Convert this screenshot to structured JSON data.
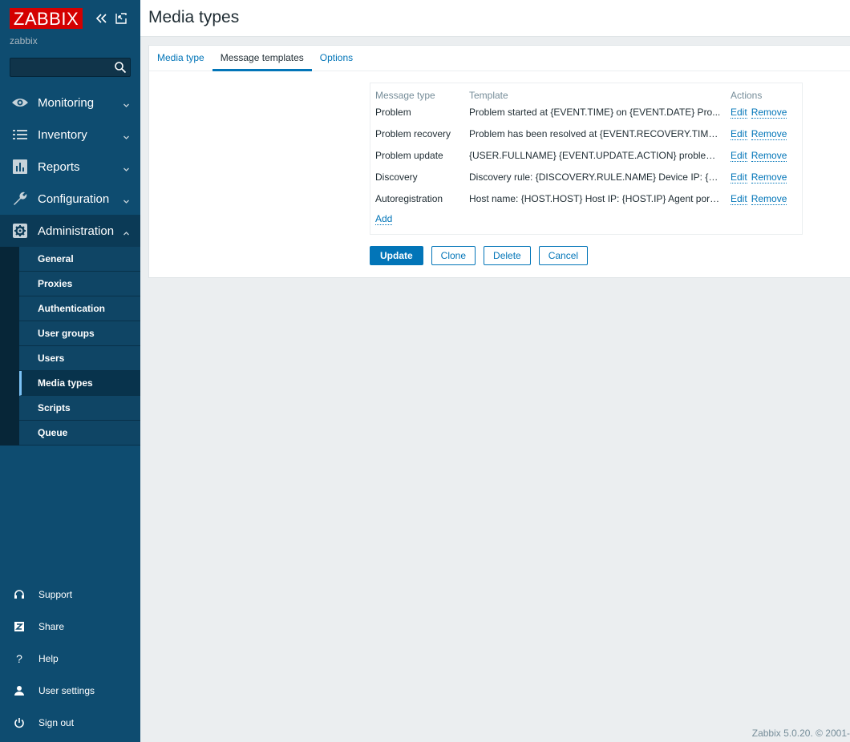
{
  "app": {
    "logo_text": "ZABBIX",
    "server_name": "zabbix"
  },
  "sidebar": {
    "menu": [
      {
        "label": "Monitoring",
        "icon": "eye-icon"
      },
      {
        "label": "Inventory",
        "icon": "list-icon"
      },
      {
        "label": "Reports",
        "icon": "bar-chart-icon"
      },
      {
        "label": "Configuration",
        "icon": "wrench-icon"
      },
      {
        "label": "Administration",
        "icon": "gear-icon",
        "expanded": true
      }
    ],
    "submenu": [
      "General",
      "Proxies",
      "Authentication",
      "User groups",
      "Users",
      "Media types",
      "Scripts",
      "Queue"
    ],
    "submenu_selected": "Media types",
    "bottom": [
      {
        "label": "Support",
        "icon": "headset-icon"
      },
      {
        "label": "Share",
        "icon": "share-z-icon"
      },
      {
        "label": "Help",
        "icon": "help-icon"
      },
      {
        "label": "User settings",
        "icon": "user-icon"
      },
      {
        "label": "Sign out",
        "icon": "power-icon"
      }
    ]
  },
  "header": {
    "title": "Media types"
  },
  "tabs": [
    {
      "label": "Media type",
      "active": false
    },
    {
      "label": "Message templates",
      "active": true
    },
    {
      "label": "Options",
      "active": false
    }
  ],
  "templates": {
    "columns": [
      "Message type",
      "Template",
      "Actions"
    ],
    "rows": [
      {
        "type": "Problem",
        "template": "Problem started at {EVENT.TIME} on {EVENT.DATE} Pro..."
      },
      {
        "type": "Problem recovery",
        "template": "Problem has been resolved at {EVENT.RECOVERY.TIME..."
      },
      {
        "type": "Problem update",
        "template": "{USER.FULLNAME} {EVENT.UPDATE.ACTION} problem ..."
      },
      {
        "type": "Discovery",
        "template": "Discovery rule: {DISCOVERY.RULE.NAME} Device IP: {D..."
      },
      {
        "type": "Autoregistration",
        "template": "Host name: {HOST.HOST} Host IP: {HOST.IP} Agent port:..."
      }
    ],
    "edit_label": "Edit",
    "remove_label": "Remove",
    "add_label": "Add"
  },
  "buttons": {
    "update": "Update",
    "clone": "Clone",
    "delete": "Delete",
    "cancel": "Cancel"
  },
  "footer": {
    "text": "Zabbix 5.0.20. © 2001-"
  },
  "colors": {
    "sidebar_bg": "#0e4c70",
    "accent": "#0275b8",
    "logo_red": "#d40000"
  }
}
